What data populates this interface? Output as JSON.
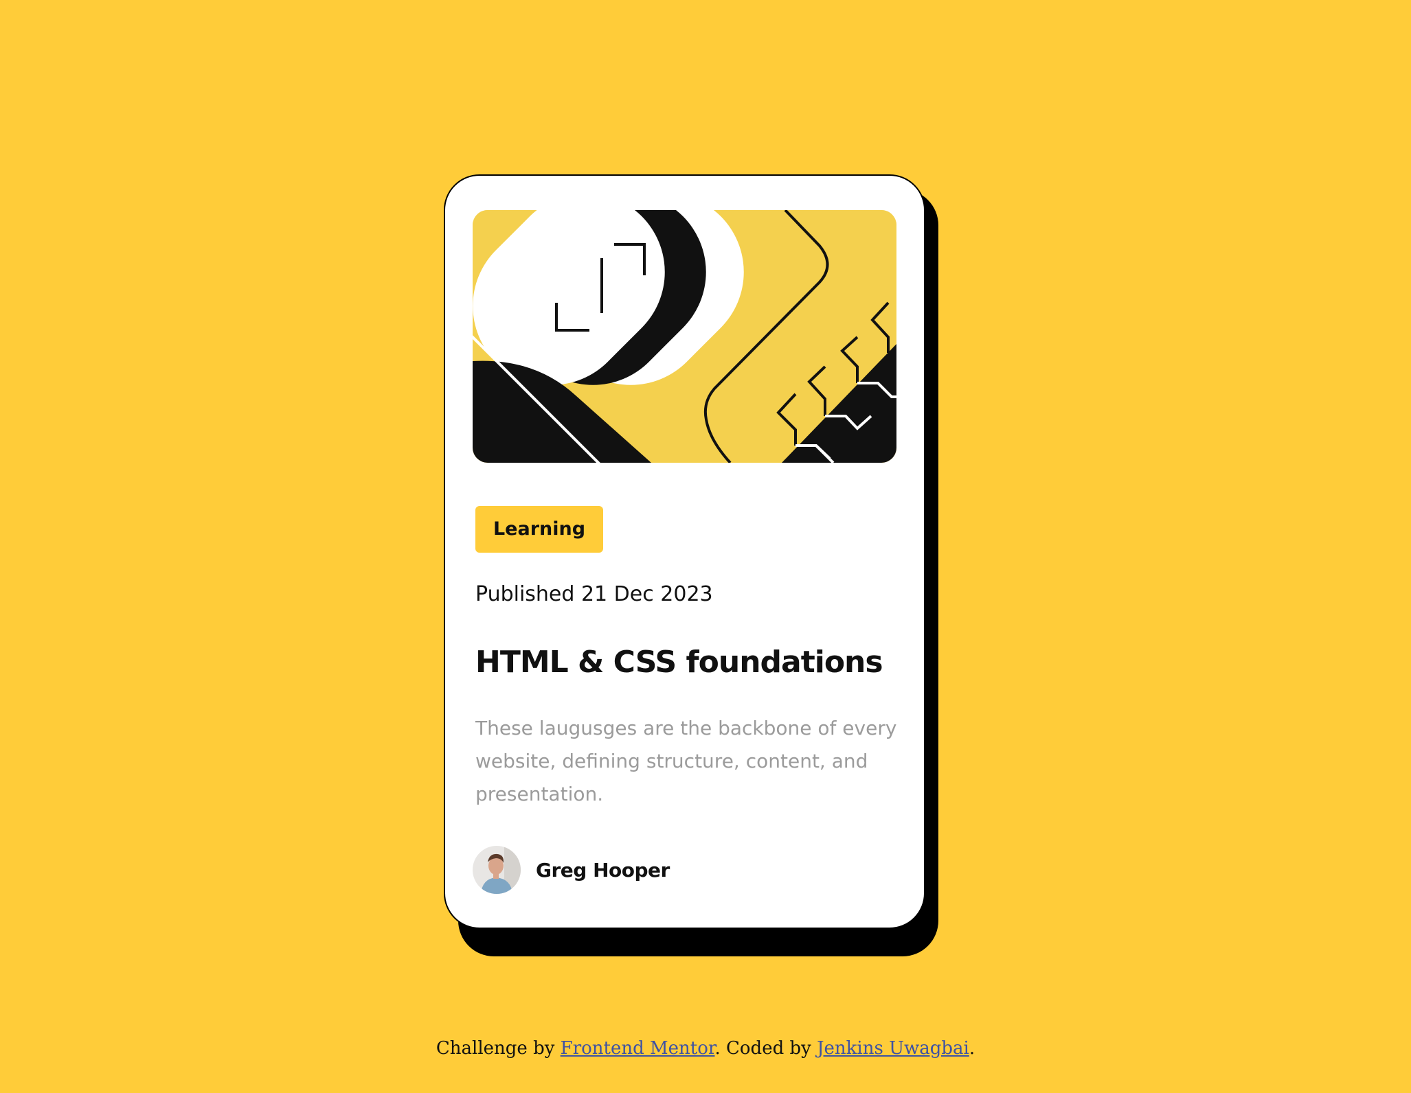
{
  "card": {
    "tag": "Learning",
    "published": "Published 21 Dec 2023",
    "title": "HTML & CSS foundations",
    "description": "These laugusges are the backbone of every website, defining structure, content, and presentation.",
    "author": {
      "name": "Greg Hooper",
      "avatar_icon": "person-avatar-icon"
    },
    "hero_icon": "code-illustration-icon"
  },
  "attribution": {
    "prefix": "Challenge by ",
    "link1": "Frontend Mentor",
    "middle": ". Coded by ",
    "link2": "Jenkins Uwagbai",
    "suffix": "."
  },
  "colors": {
    "background": "#FFCC39",
    "card": "#FFFFFF",
    "shadow": "#000000",
    "tag_bg": "#FFCC39",
    "hero_bg": "#F4D04E",
    "description": "#9B9B9B",
    "link": "#3E52A3"
  }
}
